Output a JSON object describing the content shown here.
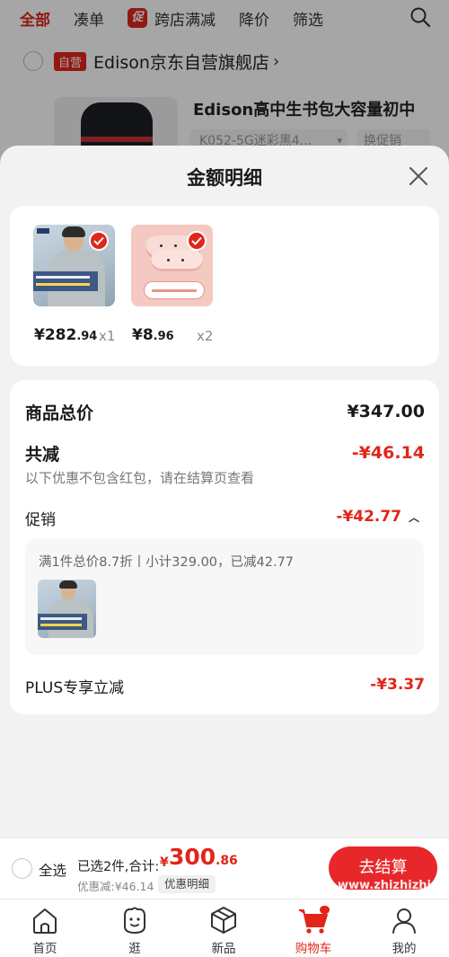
{
  "filter_bar": {
    "tabs": [
      "全部",
      "凑单",
      "跨店满减",
      "降价",
      "筛选"
    ],
    "promo_badge": "促"
  },
  "store": {
    "badge": "自营",
    "name": "Edison京东自营旗舰店",
    "chevron": "›"
  },
  "background_product": {
    "title": "Edison高中生书包大容量初中",
    "sku": "K052-5G迷彩黑4...",
    "swap": "换促销"
  },
  "sheet": {
    "title": "金额明细",
    "goods": [
      {
        "price_int": "¥282",
        "price_dec": ".94",
        "qty": "x1",
        "image": "jacket"
      },
      {
        "price_int": "¥8",
        "price_dec": ".96",
        "qty": "x2",
        "image": "slipper"
      }
    ],
    "total_label": "商品总价",
    "total_value": "¥347.00",
    "reduce_label": "共减",
    "reduce_value": "-¥46.14",
    "reduce_note": "以下优惠不包含红包，请在结算页查看",
    "promo_label": "促销",
    "promo_value": "-¥42.77",
    "promo_detail": "满1件总价8.7折丨小计329.00，已减42.77",
    "plus_label": "PLUS专享立减",
    "plus_value": "-¥3.37"
  },
  "checkout": {
    "select_all": "全选",
    "selected_text": "已选2件,合计:",
    "total_yen": "¥",
    "total_int": "300",
    "total_dec": ".86",
    "discount_text": "优惠减:¥46.14",
    "detail_button": "优惠明细",
    "checkout_button": "去结算"
  },
  "tab_bar": {
    "items": [
      {
        "label": "首页",
        "icon": "home-icon"
      },
      {
        "label": "逛",
        "icon": "browse-icon"
      },
      {
        "label": "新品",
        "icon": "cube-icon"
      },
      {
        "label": "购物车",
        "icon": "cart-icon"
      },
      {
        "label": "我的",
        "icon": "user-icon"
      }
    ],
    "active": "购物车"
  },
  "watermark": "www.zhizhizhi.com",
  "colors": {
    "accent": "#e1251b",
    "checkout_button": "#e8272b"
  }
}
